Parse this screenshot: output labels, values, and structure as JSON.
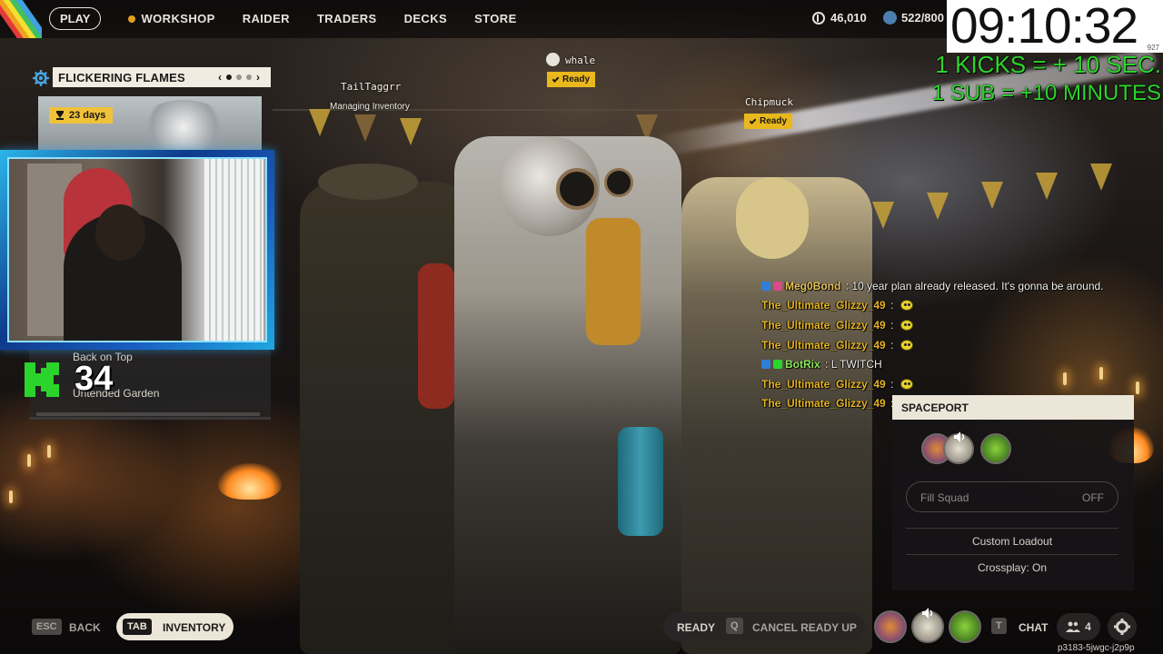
{
  "nav": {
    "play": "PLAY",
    "items": [
      "WORKSHOP",
      "RAIDER",
      "TRADERS",
      "DECKS",
      "STORE"
    ],
    "currency": "46,010",
    "tokens": "522/800"
  },
  "overlay": {
    "timer": "09:10:32",
    "timer_sub": "927",
    "promo_kicks": "1 KICKS = + 10 SEC.",
    "promo_sub": "1 SUB = +10 MINUTES",
    "kick_count": "34"
  },
  "event": {
    "title": "FLICKERING FLAMES",
    "days": "23 days",
    "lower_subtitle": "Back on Top",
    "lower_title": "Untended Garden"
  },
  "squad": [
    {
      "name": "TailTaggrr",
      "status": "Managing Inventory"
    },
    {
      "name": "whale",
      "status": "Ready"
    },
    {
      "name": "Chipmuck",
      "status": "Ready"
    }
  ],
  "chat": [
    {
      "user": "Meg0Bond",
      "color": "#e7c45a",
      "message": "10 year plan already released. It's gonna be around.",
      "emote": false
    },
    {
      "user": "The_Ultimate_Glizzy_49",
      "color": "#e7b422",
      "message": "",
      "emote": true
    },
    {
      "user": "The_Ultimate_Glizzy_49",
      "color": "#e7b422",
      "message": "",
      "emote": true
    },
    {
      "user": "The_Ultimate_Glizzy_49",
      "color": "#e7b422",
      "message": "",
      "emote": true
    },
    {
      "user": "BotRix",
      "color": "#8de85a",
      "message": "L TWITCH",
      "emote": false
    },
    {
      "user": "The_Ultimate_Glizzy_49",
      "color": "#e7b422",
      "message": "",
      "emote": true
    },
    {
      "user": "The_Ultimate_Glizzy_49",
      "color": "#e7b422",
      "message": "",
      "emote": true
    }
  ],
  "spaceport": {
    "title": "SPACEPORT",
    "fill_squad_label": "Fill Squad",
    "fill_squad_value": "OFF",
    "custom_loadout": "Custom Loadout",
    "crossplay": "Crossplay: On"
  },
  "bottom": {
    "esc_key": "ESC",
    "back": "BACK",
    "tab_key": "TAB",
    "inventory": "INVENTORY",
    "ready": "READY",
    "q_key": "Q",
    "cancel_ready": "CANCEL READY UP",
    "t_key": "T",
    "chat": "CHAT",
    "squad_count": "4",
    "lobby_code": "p3183-5jwgc-j2p9p"
  },
  "colors": {
    "accent_yellow": "#e9b81c",
    "kick_green": "#2bd42b",
    "panel_cream": "#ece6d9"
  }
}
